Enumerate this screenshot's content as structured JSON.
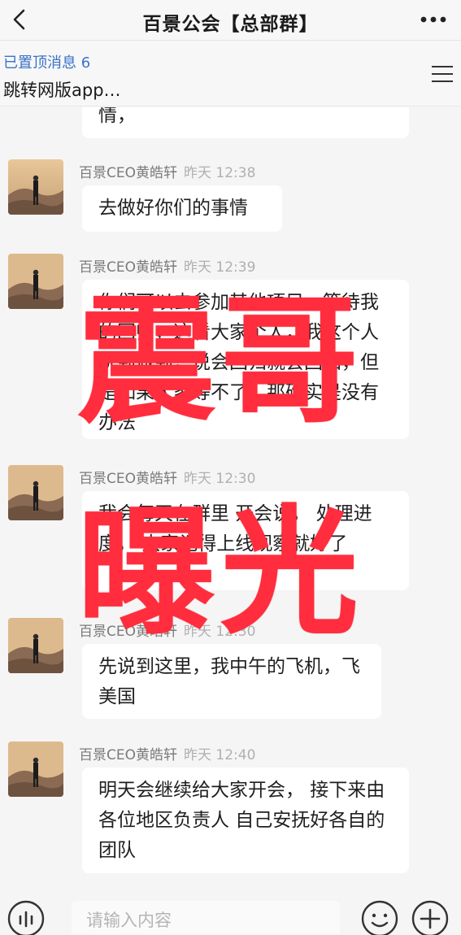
{
  "header": {
    "title": "百景公会【总部群】"
  },
  "pinned": {
    "count_label": "已置顶消息 6",
    "text": "跳转网版app…"
  },
  "messages": [
    {
      "sender": "",
      "time": "",
      "text": "情，"
    },
    {
      "sender": "百景CEO黄皓轩",
      "time": "昨天 12:38",
      "text": "去做好你们的事情"
    },
    {
      "sender": "百景CEO黄皓轩",
      "time": "昨天 12:39",
      "text": "你们可以去参加其他项目，等待我的回归，这看大家个人，我这个人说到做到，说会回归就会回归，但是如果大家等不了，那确实是没有办法"
    },
    {
      "sender": "百景CEO黄皓轩",
      "time": "昨天 12:30",
      "text": "我会每天在群里 开会说， 处理进度， 大家记得上线观察就好了"
    },
    {
      "sender": "百景CEO黄皓轩",
      "time": "昨天 12:30",
      "text": "先说到这里，我中午的飞机，飞美国"
    },
    {
      "sender": "百景CEO黄皓轩",
      "time": "昨天 12:40",
      "text": "明天会继续给大家开会， 接下来由各位地区负责人   自己安抚好各自的团队"
    }
  ],
  "overlay": {
    "line1": "震哥",
    "line2": "曝光",
    "color": "#ff2d3d"
  },
  "input": {
    "placeholder": "请输入内容"
  },
  "icons": {
    "back": "chevron-left-icon",
    "more": "more-dots-icon",
    "menu": "hamburger-menu-icon",
    "voice": "voice-icon",
    "emoji": "emoji-icon",
    "plus": "plus-icon"
  },
  "colors": {
    "bubble_bg": "#ffffff",
    "page_bg": "#f5f5f5",
    "pinned_accent": "#3a72c8"
  }
}
